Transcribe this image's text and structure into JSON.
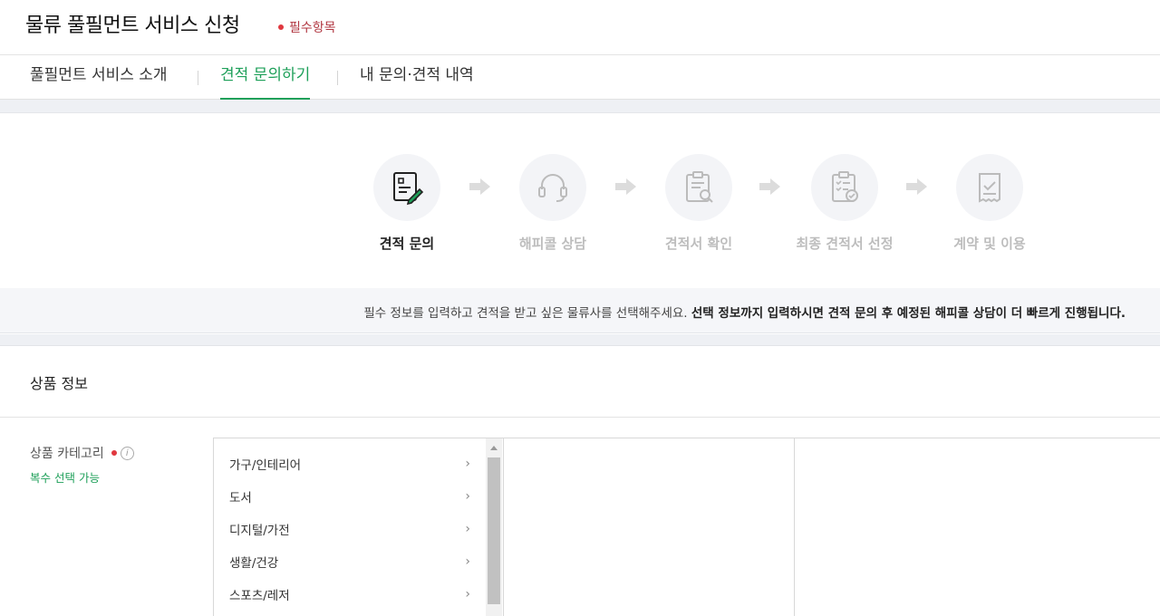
{
  "header": {
    "title": "물류 풀필먼트 서비스 신청",
    "required_note": "필수항목"
  },
  "tabs": [
    {
      "label": "풀필먼트 서비스 소개",
      "active": false
    },
    {
      "label": "견적 문의하기",
      "active": true
    },
    {
      "label": "내 문의·견적 내역",
      "active": false
    }
  ],
  "steps": [
    {
      "label": "견적 문의",
      "icon": "form-pencil-icon",
      "active": true
    },
    {
      "label": "해피콜 상담",
      "icon": "headset-icon",
      "active": false
    },
    {
      "label": "견적서 확인",
      "icon": "clipboard-search-icon",
      "active": false
    },
    {
      "label": "최종 견적서 선정",
      "icon": "clipboard-check-icon",
      "active": false
    },
    {
      "label": "계약 및 이용",
      "icon": "receipt-check-icon",
      "active": false
    }
  ],
  "banner": {
    "text": "필수 정보를 입력하고 견적을 받고 싶은 물류사를 선택해주세요. ",
    "bold": "선택 정보까지 입력하시면 견적 문의 후 예정된 해피콜 상담이 더 빠르게 진행됩니다."
  },
  "section": {
    "title": "상품 정보",
    "field_label": "상품 카테고리",
    "field_note": "복수 선택 가능",
    "categories": [
      "가구/인테리어",
      "도서",
      "디지털/가전",
      "생활/건강",
      "스포츠/레저"
    ]
  },
  "colors": {
    "accent": "#1fa05a",
    "required": "#e0383f"
  }
}
